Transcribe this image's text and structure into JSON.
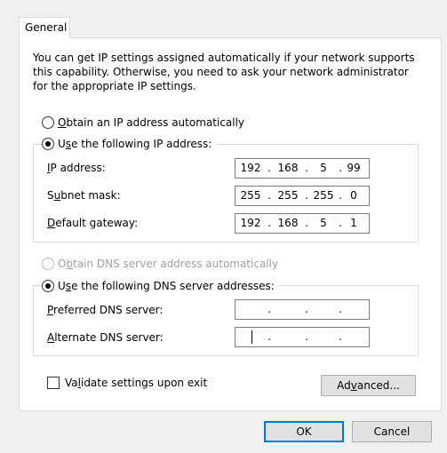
{
  "tab": {
    "label": "General"
  },
  "intro": {
    "line1": "You can get IP settings assigned automatically if your network supports",
    "line2": "this capability. Otherwise, you need to ask your network administrator",
    "line3": "for the appropriate IP settings."
  },
  "ip": {
    "auto_key": "O",
    "auto_rest": "btain an IP address automatically",
    "manual_key": "s",
    "manual_pre": "U",
    "manual_rest": "e the following IP address:",
    "selected": "manual",
    "address": {
      "key": "I",
      "rest": "P address:",
      "octets": [
        "192",
        "168",
        "5",
        "99"
      ]
    },
    "subnet": {
      "pre": "S",
      "key": "u",
      "rest": "bnet mask:",
      "octets": [
        "255",
        "255",
        "255",
        "0"
      ]
    },
    "gateway": {
      "key": "D",
      "rest": "efault gateway:",
      "octets": [
        "192",
        "168",
        "5",
        "1"
      ]
    }
  },
  "dns": {
    "auto_pre": "O",
    "auto_key": "b",
    "auto_rest": "tain DNS server address automatically",
    "auto_disabled": true,
    "manual_pre": "U",
    "manual_key": "s",
    "manual_rest": "e the following DNS server addresses:",
    "selected": "manual",
    "preferred": {
      "key": "P",
      "rest": "referred DNS server:",
      "octets": [
        "",
        "",
        "",
        ""
      ]
    },
    "alternate": {
      "key": "A",
      "rest": "lternate DNS server:",
      "octets": [
        "",
        "",
        "",
        ""
      ]
    }
  },
  "validate": {
    "pre": "Va",
    "key": "l",
    "rest": "idate settings upon exit",
    "checked": false
  },
  "buttons": {
    "advanced_pre": "Ad",
    "advanced_key": "v",
    "advanced_rest": "anced...",
    "ok": "OK",
    "cancel": "Cancel"
  }
}
